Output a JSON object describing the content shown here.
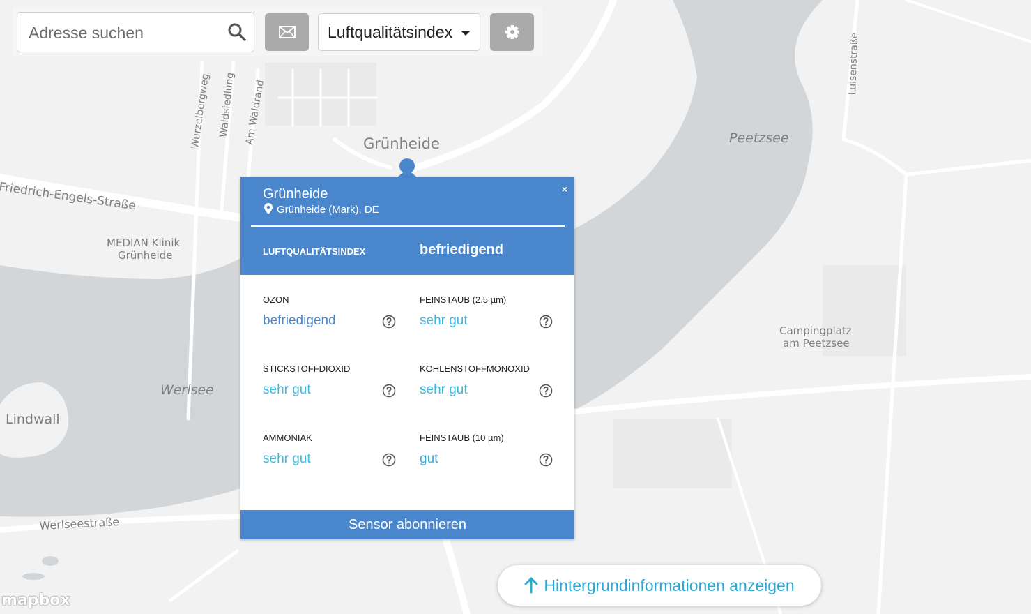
{
  "search": {
    "placeholder": "Adresse suchen"
  },
  "layer_select": {
    "selected": "Luftqualitätsindex"
  },
  "map_labels": {
    "gruenheide": "Grünheide",
    "friedrich": "Friedrich-Engels-Straße",
    "wurzelbergweg": "Wurzelbergweg",
    "waldsiedlung": "Waldsiedlung",
    "am_waldrand": "Am Waldrand",
    "median_1": "MEDIAN Klinik",
    "median_2": "Grünheide",
    "peetzsee": "Peetzsee",
    "luisenstrasse": "Luisenstraße",
    "camping_1": "Campingplatz",
    "camping_2": "am Peetzsee",
    "werlsee": "Werlsee",
    "lindwall": "Lindwall",
    "werlseestrasse": "Werlseestraße"
  },
  "popup": {
    "title": "Grünheide",
    "subtitle": "Grünheide (Mark), DE",
    "close": "×",
    "aqi_label": "LUFTQUALITÄTSINDEX",
    "aqi_value": "befriedigend",
    "pollutants": [
      {
        "label": "OZON",
        "value": "befriedigend",
        "color": "#4a86cc"
      },
      {
        "label": "FEINSTAUB (2.5 µm)",
        "value": "sehr gut",
        "color": "#3db8de"
      },
      {
        "label": "STICKSTOFFDIOXID",
        "value": "sehr gut",
        "color": "#3db8de"
      },
      {
        "label": "KOHLENSTOFFMONOXID",
        "value": "sehr gut",
        "color": "#3db8de"
      },
      {
        "label": "AMMONIAK",
        "value": "sehr gut",
        "color": "#3db8de"
      },
      {
        "label": "FEINSTAUB (10 µm)",
        "value": "gut",
        "color": "#3aaad8"
      }
    ],
    "subscribe": "Sensor abonnieren"
  },
  "info_button": {
    "label": "Hintergrundinformationen anzeigen"
  },
  "attribution": {
    "logo": "mapbox"
  },
  "colors": {
    "water": "#d3d6d9",
    "land": "#f2f2f2",
    "road": "#ffffff",
    "accent": "#4a86cc",
    "link": "#3db8de"
  }
}
